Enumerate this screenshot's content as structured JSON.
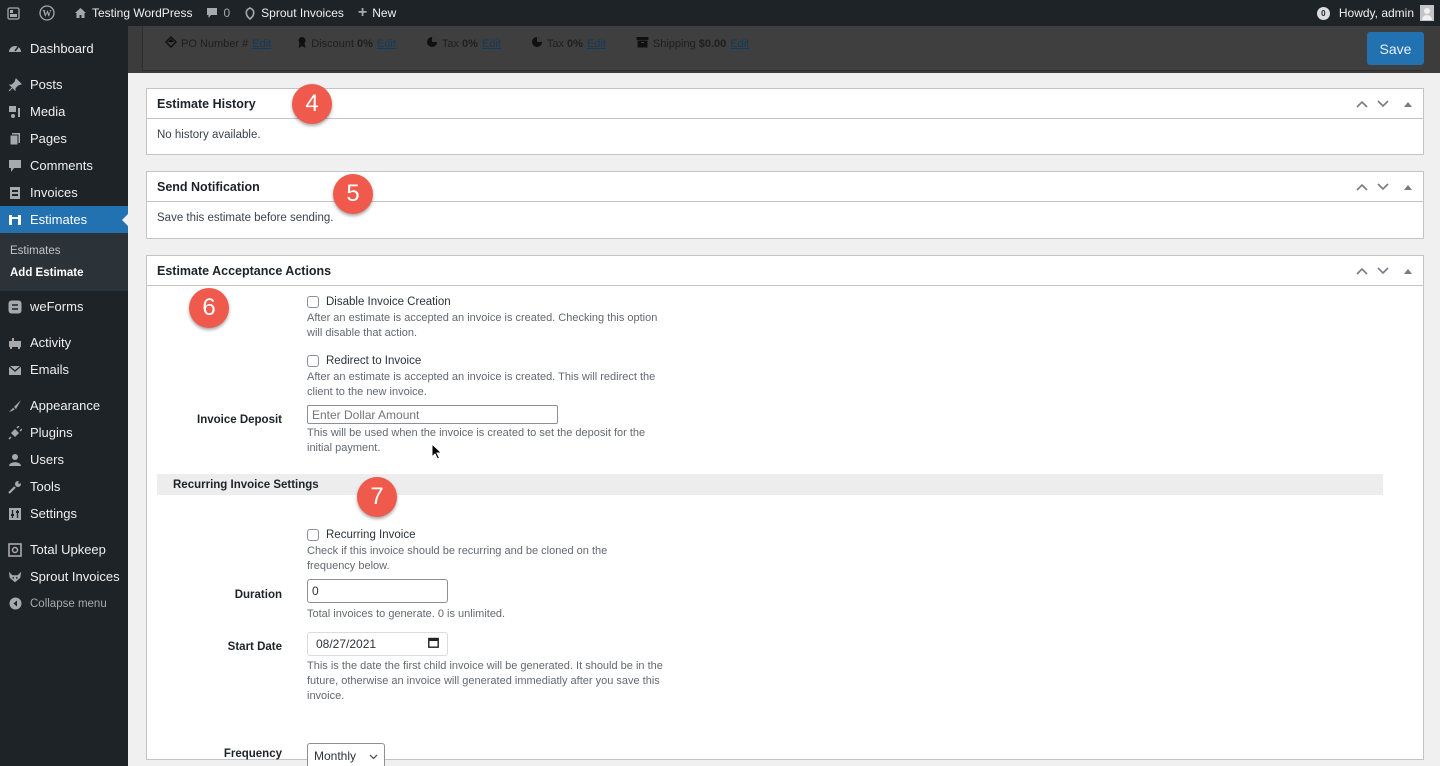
{
  "adminbar": {
    "site_name": "Testing WordPress",
    "comments_count": "0",
    "plugin_link": "Sprout Invoices",
    "new_label": "New",
    "notifications_count": "0",
    "greeting": "Howdy, admin"
  },
  "sidebar": {
    "items": [
      {
        "label": "Dashboard",
        "icon": "dashboard-icon"
      },
      {
        "label": "Posts",
        "icon": "pin-icon"
      },
      {
        "label": "Media",
        "icon": "media-icon"
      },
      {
        "label": "Pages",
        "icon": "pages-icon"
      },
      {
        "label": "Comments",
        "icon": "comment-icon"
      },
      {
        "label": "Invoices",
        "icon": "invoice-icon"
      },
      {
        "label": "Estimates",
        "icon": "estimates-icon",
        "current": true
      },
      {
        "label": "weForms",
        "icon": "weforms-icon"
      },
      {
        "label": "Activity",
        "icon": "activity-icon"
      },
      {
        "label": "Emails",
        "icon": "email-icon"
      },
      {
        "label": "Appearance",
        "icon": "brush-icon"
      },
      {
        "label": "Plugins",
        "icon": "plug-icon"
      },
      {
        "label": "Users",
        "icon": "user-icon"
      },
      {
        "label": "Tools",
        "icon": "wrench-icon"
      },
      {
        "label": "Settings",
        "icon": "settings-icon"
      },
      {
        "label": "Total Upkeep",
        "icon": "safe-icon"
      },
      {
        "label": "Sprout Invoices",
        "icon": "fox-icon"
      },
      {
        "label": "Collapse menu",
        "icon": "collapse-icon"
      }
    ],
    "submenu": [
      {
        "label": "Estimates"
      },
      {
        "label": "Add Estimate",
        "current": true
      }
    ]
  },
  "metabar": {
    "po_label": "PO Number #",
    "discount_label": "Discount",
    "discount_value": "0%",
    "tax1_label": "Tax",
    "tax1_value": "0%",
    "tax2_label": "Tax",
    "tax2_value": "0%",
    "shipping_label": "Shipping",
    "shipping_value": "$0.00",
    "edit_label": "Edit",
    "save_label": "Save"
  },
  "panels": {
    "history": {
      "title": "Estimate History",
      "body": "No history available."
    },
    "notification": {
      "title": "Send Notification",
      "body": "Save this estimate before sending."
    },
    "acceptance": {
      "title": "Estimate Acceptance Actions",
      "disable_invoice": {
        "label": "Disable Invoice Creation",
        "checked": false,
        "desc": "After an estimate is accepted an invoice is created. Checking this option will disable that action."
      },
      "redirect_invoice": {
        "label": "Redirect to Invoice",
        "checked": false,
        "desc": "After an estimate is accepted an invoice is created. This will redirect the client to the new invoice."
      },
      "deposit": {
        "label": "Invoice Deposit",
        "placeholder": "Enter Dollar Amount",
        "value": "",
        "desc": "This will be used when the invoice is created to set the deposit for the initial payment."
      },
      "recurring_section": "Recurring Invoice Settings",
      "recurring": {
        "label": "Recurring Invoice",
        "checked": false,
        "desc": "Check if this invoice should be recurring and be cloned on the frequency below."
      },
      "duration": {
        "label": "Duration",
        "value": "0",
        "desc": "Total invoices to generate. 0 is unlimited."
      },
      "start_date": {
        "label": "Start Date",
        "value": "08/27/2021",
        "desc": "This is the date the first child invoice will be generated. It should be in the future, otherwise an invoice will generated immediatly after you save this invoice."
      },
      "frequency": {
        "label": "Frequency",
        "value": "Monthly"
      }
    }
  },
  "callouts": [
    "4",
    "5",
    "6",
    "7"
  ],
  "colors": {
    "accent": "#2271b1",
    "callout": "#ef5a4c",
    "adminbar": "#1d2327"
  }
}
